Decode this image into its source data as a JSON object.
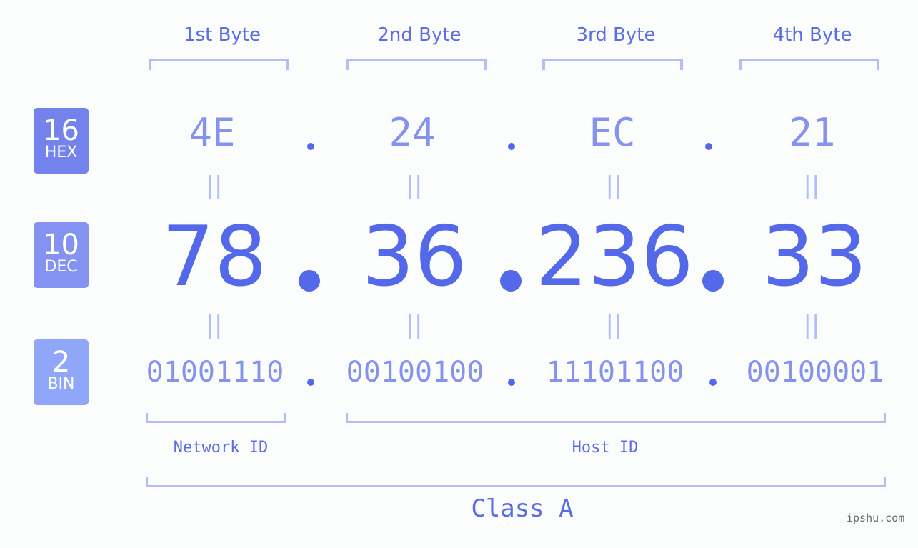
{
  "bases": [
    {
      "number": "16",
      "label": "HEX",
      "color": "#7483eb"
    },
    {
      "number": "10",
      "label": "DEC",
      "color": "#8493f1"
    },
    {
      "number": "2",
      "label": "BIN",
      "color": "#8fa6f9"
    }
  ],
  "bytes": [
    {
      "title": "1st Byte",
      "hex": "4E",
      "dec": "78",
      "bin": "01001110"
    },
    {
      "title": "2nd Byte",
      "hex": "24",
      "dec": "36",
      "bin": "00100100"
    },
    {
      "title": "3rd Byte",
      "hex": "EC",
      "dec": "236",
      "bin": "11101100"
    },
    {
      "title": "4th Byte",
      "hex": "21",
      "dec": "33",
      "bin": "00100001"
    }
  ],
  "equals_symbol": "||",
  "network_label": "Network ID",
  "host_label": "Host ID",
  "class_label": "Class A",
  "watermark": "ipshu.com"
}
